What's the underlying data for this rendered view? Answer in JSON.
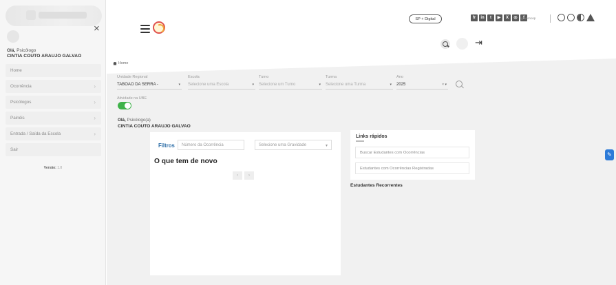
{
  "sidebar": {
    "greeting_prefix": "Olá,",
    "greeting_role": "Psicólogo",
    "user_name": "CINTIA COUTO ARAUJO GALVAO",
    "items": [
      {
        "label": "Home",
        "has_chevron": false
      },
      {
        "label": "Ocorrência",
        "has_chevron": true
      },
      {
        "label": "Psicólogos",
        "has_chevron": true
      },
      {
        "label": "Painéis",
        "has_chevron": true
      },
      {
        "label": "Entrada / Saída da Escola",
        "has_chevron": true
      },
      {
        "label": "Sair",
        "has_chevron": false
      }
    ],
    "version_label": "Versão:",
    "version_value": "1.0"
  },
  "header": {
    "sp_digital_label": "SP + Digital",
    "social_handle": "/governosp",
    "social_icons": [
      "flickr-icon",
      "linkedin-icon",
      "tiktok-icon",
      "youtube-icon",
      "x-icon",
      "instagram-icon",
      "facebook-icon"
    ],
    "social_glyphs": [
      "fr",
      "in",
      "t",
      "▶",
      "X",
      "◎",
      "f"
    ]
  },
  "breadcrumb": {
    "home": "Home"
  },
  "filters": {
    "unidade_label": "Unidade Regional",
    "unidade_value": "TABOAO DA SERRA -",
    "escola_label": "Escola",
    "escola_placeholder": "Selecione uma Escola",
    "turno_label": "Turno",
    "turno_placeholder": "Selecione um Turno",
    "turma_label": "Turma",
    "turma_placeholder": "Selecione uma Turma",
    "ano_label": "Ano",
    "ano_value": "2025",
    "clear_caret": "×  ▾"
  },
  "toggle": {
    "label": "Atividade na UBE"
  },
  "main": {
    "greeting_prefix": "Olá,",
    "greeting_role": "Psicólogo(a)",
    "user_name": "CINTIA COUTO ARAUJO GALVAO",
    "filtros_label": "Filtros",
    "ocorrencia_placeholder": "Número da Ocorrência",
    "gravidade_placeholder": "Selecione uma Gravidade",
    "novo_title": "O que tem de novo",
    "prev": "‹",
    "next": "›"
  },
  "quick_links": {
    "title": "Links rápidos",
    "links": [
      "Buscar Estudantes com Ocorrências",
      "Estudantes com Ocorrências Registradas"
    ],
    "recorrentes": "Estudantes Recorrentes"
  },
  "colors": {
    "accent": "#2f6fa8",
    "toggle_on": "#3fb24a",
    "help_button": "#2d7bd8"
  }
}
